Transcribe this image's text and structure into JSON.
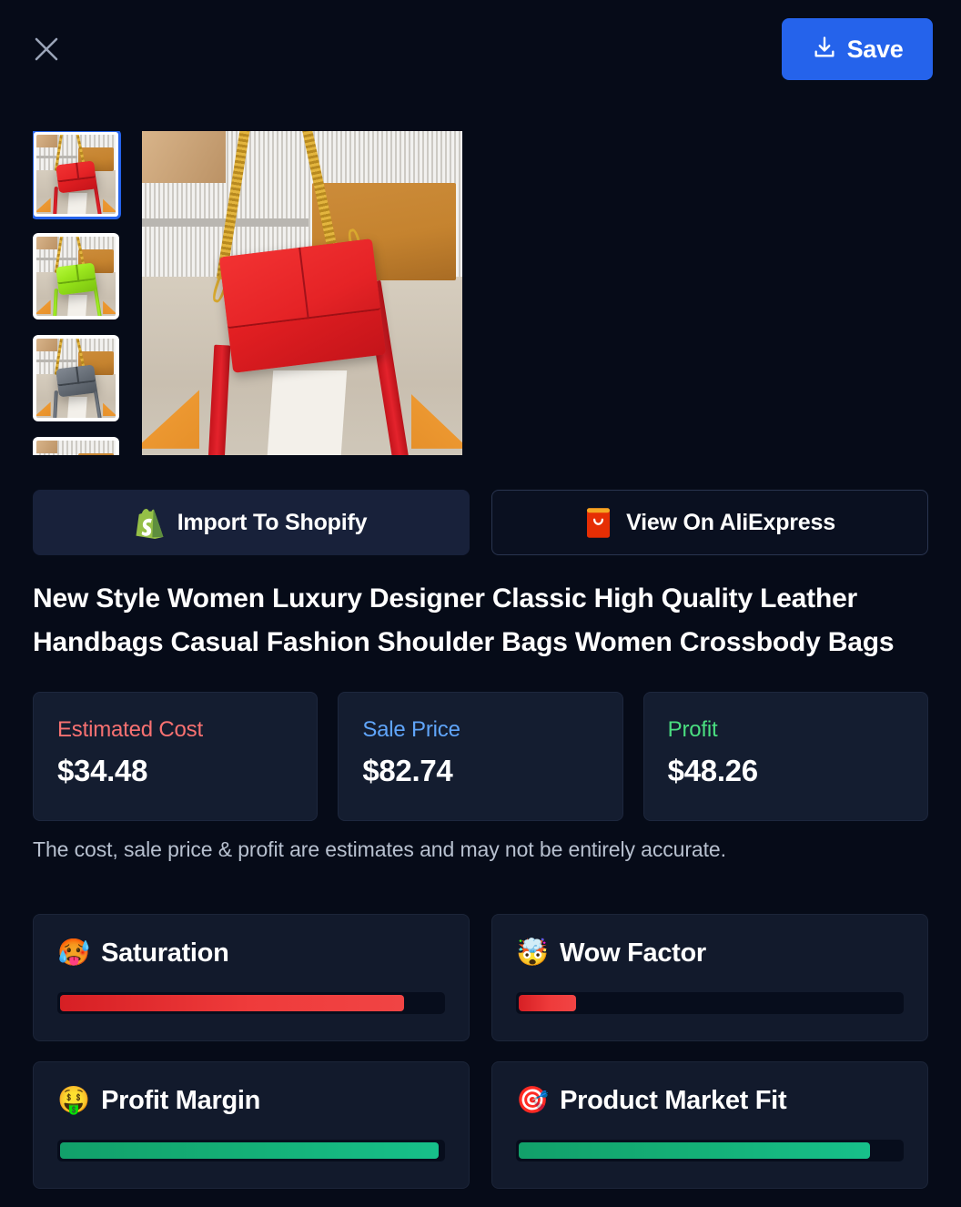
{
  "topbar": {
    "close_icon": "close-icon",
    "save_label": "Save",
    "save_icon": "download-icon",
    "save_color": "#2563EB"
  },
  "gallery": {
    "thumbnails": [
      {
        "alt": "red handbag",
        "selected": true
      },
      {
        "alt": "green handbag",
        "selected": false
      },
      {
        "alt": "grey handbag",
        "selected": false
      },
      {
        "alt": "handbag variant",
        "selected": false
      }
    ],
    "main_image_alt": "red leather crossbody handbag with gold chain"
  },
  "actions": {
    "shopify": {
      "label": "Import To Shopify",
      "icon": "shopify-icon"
    },
    "aliexpress": {
      "label": "View On AliExpress",
      "icon": "aliexpress-icon"
    }
  },
  "product": {
    "title": "New Style Women Luxury Designer Classic High Quality Leather Handbags Casual Fashion Shoulder Bags Women Crossbody Bags"
  },
  "prices": [
    {
      "label": "Estimated Cost",
      "value": "$34.48",
      "color": "#F87171"
    },
    {
      "label": "Sale Price",
      "value": "$82.74",
      "color": "#60A5FA"
    },
    {
      "label": "Profit",
      "value": "$48.26",
      "color": "#4ADE80"
    }
  ],
  "disclaimer": "The cost, sale price & profit are estimates and may not be entirely accurate.",
  "metrics": [
    {
      "emoji": "🥵",
      "icon": "hot-face-icon",
      "label": "Saturation",
      "percent": 90,
      "tone": "red"
    },
    {
      "emoji": "🤯",
      "icon": "exploding-head-icon",
      "label": "Wow Factor",
      "percent": 15,
      "tone": "red"
    },
    {
      "emoji": "🤑",
      "icon": "money-mouth-face-icon",
      "label": "Profit Margin",
      "percent": 99,
      "tone": "green"
    },
    {
      "emoji": "🎯",
      "icon": "bullseye-icon",
      "label": "Product Market Fit",
      "percent": 92,
      "tone": "green"
    }
  ]
}
